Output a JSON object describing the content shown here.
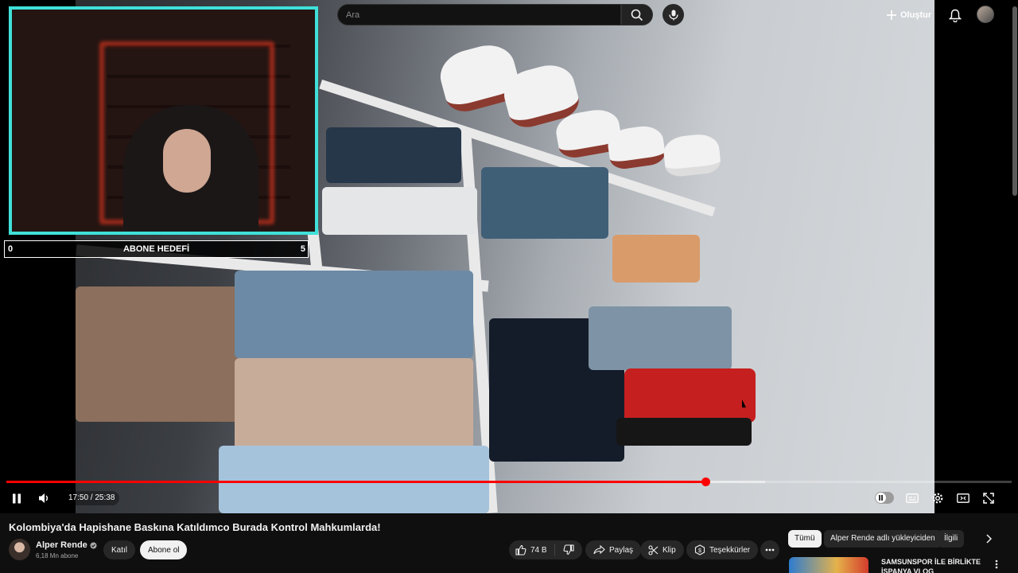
{
  "masthead": {
    "search_placeholder": "Ara",
    "create_label": "Oluştur"
  },
  "overlay": {
    "goal_title": "ABONE HEDEFİ",
    "goal_min": "0",
    "goal_max": "5"
  },
  "player": {
    "time_display": "17:50 / 25:38",
    "progress_played": 0.6957,
    "progress_buffered": 0.755
  },
  "video": {
    "title": "Kolombiya'da Hapishane Baskına Katıldımco Burada Kontrol Mahkumlarda!",
    "channel_name": "Alper Rende",
    "subscribers": "6,18 Mn abone",
    "join_label": "Katıl",
    "subscribe_label": "Abone ol",
    "like_count": "74 B",
    "share_label": "Paylaş",
    "clip_label": "Klip",
    "thanks_label": "Teşekkürler"
  },
  "chips": [
    "Tümü",
    "Alper Rende adlı yükleyiciden",
    "İlgili"
  ],
  "recommendation": {
    "title": "SAMSUNSPOR İLE BİRLİKTE İSPANYA VLOG"
  },
  "colors": {
    "accent_red": "#ff0000",
    "webcam_border": "#3fe0d9",
    "background": "#0f0f0f"
  }
}
